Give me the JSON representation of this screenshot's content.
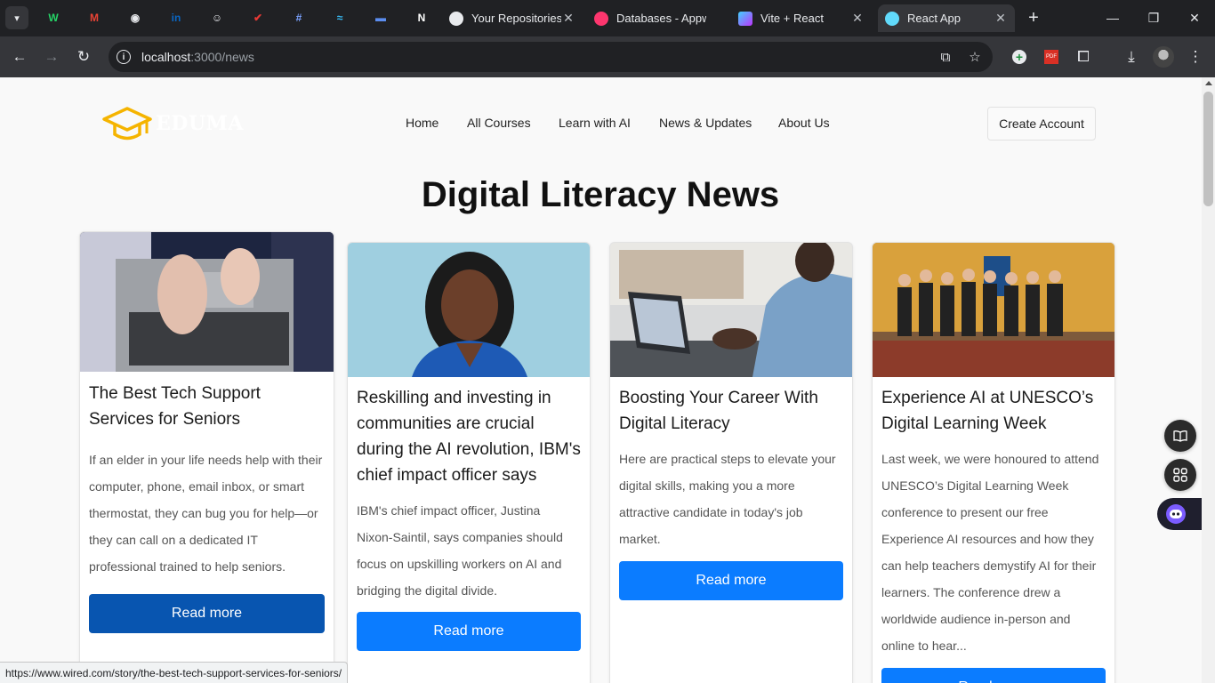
{
  "browser": {
    "pinned_tabs": [
      {
        "icon": "whatsapp-icon",
        "glyph": "W",
        "color": "#25d366"
      },
      {
        "icon": "gmail-icon",
        "glyph": "M",
        "color": "#ea4335"
      },
      {
        "icon": "github-icon",
        "glyph": "◉",
        "color": "#e8eaed"
      },
      {
        "icon": "linkedin-icon",
        "glyph": "in",
        "color": "#0a66c2"
      },
      {
        "icon": "chatbot-icon",
        "glyph": "☺",
        "color": "#e8eaed"
      },
      {
        "icon": "checkmark-icon",
        "glyph": "✔",
        "color": "#e53935"
      },
      {
        "icon": "hashtag-icon",
        "glyph": "#",
        "color": "#7aa2ff"
      },
      {
        "icon": "tailwind-icon",
        "glyph": "≈",
        "color": "#38bdf8"
      },
      {
        "icon": "app-icon",
        "glyph": "▬",
        "color": "#5b8def"
      },
      {
        "icon": "nextjs-icon",
        "glyph": "N",
        "color": "#ffffff"
      }
    ],
    "tabs": [
      {
        "title": "Your Repositories",
        "icon": "github-icon",
        "color": "#e8eaed"
      },
      {
        "title": "Databases - Appwrite",
        "icon": "appwrite-icon",
        "color": "#fd366e"
      },
      {
        "title": "Vite + React",
        "icon": "vite-icon",
        "color": "#a855f7"
      },
      {
        "title": "React App",
        "icon": "react-icon",
        "color": "#61dafb"
      }
    ],
    "url_host": "localhost",
    "url_path": ":3000/news",
    "status_url": "https://www.wired.com/story/the-best-tech-support-services-for-seniors/"
  },
  "site": {
    "logo_text": "EDUMA",
    "nav": [
      "Home",
      "All Courses",
      "Learn with AI",
      "News & Updates",
      "About Us"
    ],
    "create_account": "Create Account",
    "page_title": "Digital Literacy News"
  },
  "articles": [
    {
      "title": "The Best Tech Support Services for Seniors",
      "summary": "If an elder in your life needs help with their computer, phone, email inbox, or smart thermostat, they can bug you for help—or they can call on a dedicated IT professional trained to help seniors.",
      "button": "Read more",
      "image": "laptop-typing-image"
    },
    {
      "title": "Reskilling and investing in communities are crucial during the AI revolution, IBM's chief impact officer says",
      "summary": "IBM's chief impact officer, Justina Nixon-Saintil, says companies should focus on upskilling workers on AI and bridging the digital divide.",
      "button": "Read more",
      "image": "portrait-image"
    },
    {
      "title": "Boosting Your Career With Digital Literacy",
      "summary": "Here are practical steps to elevate your digital skills, making you a more attractive candidate in today's job market.",
      "button": "Read more",
      "image": "laptop-desk-image"
    },
    {
      "title": "Experience AI at UNESCO’s Digital Learning Week",
      "summary": "Last week, we were honoured to attend UNESCO’s Digital Learning Week conference to present our free Experience AI resources and how they can help teachers demystify AI for their learners.   The conference drew a worldwide audience in-person and online to hear...",
      "button": "Read more",
      "image": "conference-group-image"
    }
  ],
  "colors": {
    "accent_blue": "#0b7cff",
    "hover_blue": "#0855b0",
    "logo_gold": "#f5b400"
  }
}
